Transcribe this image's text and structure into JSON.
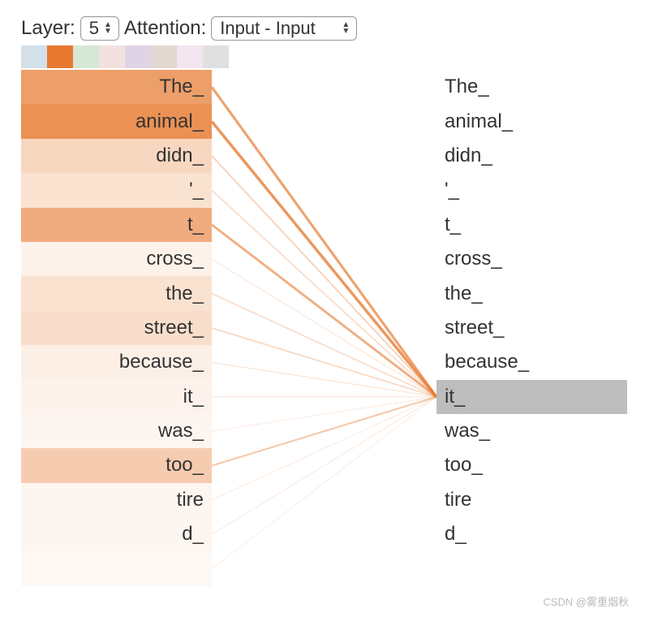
{
  "controls": {
    "layer_label": "Layer:",
    "layer_value": "5",
    "attention_label": "Attention:",
    "attention_value": "Input - Input"
  },
  "heads": [
    {
      "color": "#aec7d8",
      "selected": false
    },
    {
      "color": "#e6792f",
      "selected": true
    },
    {
      "color": "#b5d4b2",
      "selected": false
    },
    {
      "color": "#e9c8c6",
      "selected": false
    },
    {
      "color": "#c4b1d1",
      "selected": false
    },
    {
      "color": "#ccb6ab",
      "selected": false
    },
    {
      "color": "#e9cde3",
      "selected": false
    },
    {
      "color": "#c7c7c7",
      "selected": false
    }
  ],
  "tokens_left": [
    "The_",
    "animal_",
    "didn_",
    "'_",
    "t_",
    "cross_",
    "the_",
    "street_",
    "because_",
    "it_",
    "was_",
    "too_",
    "tire",
    "d_",
    ""
  ],
  "tokens_right": [
    "The_",
    "animal_",
    "didn_",
    "'_",
    "t_",
    "cross_",
    "the_",
    "street_",
    "because_",
    "it_",
    "was_",
    "too_",
    "tire",
    "d_"
  ],
  "selected_right_index": 9,
  "attention_weights": [
    0.72,
    0.82,
    0.3,
    0.22,
    0.62,
    0.1,
    0.22,
    0.25,
    0.12,
    0.09,
    0.07,
    0.38,
    0.07,
    0.07,
    0.05
  ],
  "attention_color": "#e6792f",
  "layout": {
    "left_x_end": 241,
    "right_x_start": 518,
    "row_height": 42.4
  },
  "watermark": "CSDN @雾重烟秋"
}
